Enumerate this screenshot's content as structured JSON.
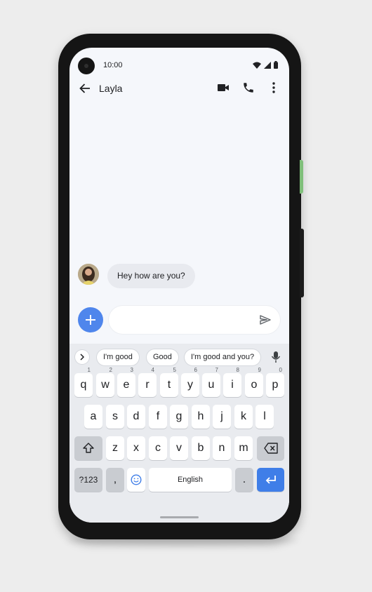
{
  "status_bar": {
    "time": "10:00"
  },
  "app_bar": {
    "contact_name": "Layla"
  },
  "conversation": {
    "messages": [
      {
        "sender": "Layla",
        "text": "Hey how are you?"
      }
    ]
  },
  "compose": {
    "placeholder": ""
  },
  "keyboard": {
    "suggestions": [
      "I'm good",
      "Good",
      "I'm good and you?"
    ],
    "row1": [
      {
        "label": "q",
        "hint": "1"
      },
      {
        "label": "w",
        "hint": "2"
      },
      {
        "label": "e",
        "hint": "3"
      },
      {
        "label": "r",
        "hint": "4"
      },
      {
        "label": "t",
        "hint": "5"
      },
      {
        "label": "y",
        "hint": "6"
      },
      {
        "label": "u",
        "hint": "7"
      },
      {
        "label": "i",
        "hint": "8"
      },
      {
        "label": "o",
        "hint": "9"
      },
      {
        "label": "p",
        "hint": "0"
      }
    ],
    "row2": [
      "a",
      "s",
      "d",
      "f",
      "g",
      "h",
      "j",
      "k",
      "l"
    ],
    "row3": [
      "z",
      "x",
      "c",
      "v",
      "b",
      "n",
      "m"
    ],
    "symbols_label": "?123",
    "comma_label": ",",
    "space_label": "English",
    "period_label": "."
  },
  "colors": {
    "accent": "#3f7ee8",
    "fab": "#4f86ec",
    "background": "#f5f7fb"
  },
  "icons": [
    "back-arrow-icon",
    "video-call-icon",
    "phone-icon",
    "more-vert-icon",
    "plus-icon",
    "send-icon",
    "chevron-right-icon",
    "mic-icon",
    "shift-icon",
    "backspace-icon",
    "emoji-icon",
    "enter-icon",
    "wifi-icon",
    "signal-icon",
    "battery-icon"
  ]
}
